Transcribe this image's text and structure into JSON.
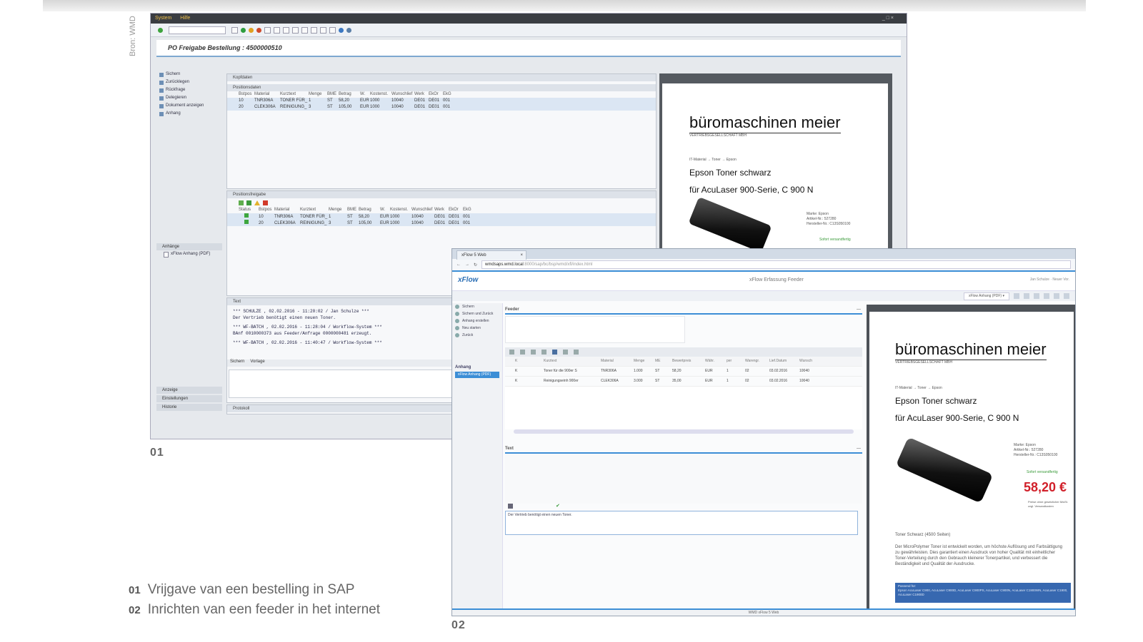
{
  "source_label": "Bron: WMD",
  "figures": [
    {
      "number": "01",
      "caption": "Vrijgave van een bestelling in SAP"
    },
    {
      "number": "02",
      "caption": "Inrichten van een feeder in het internet"
    }
  ],
  "sap": {
    "menu": [
      "System",
      "Hilfe"
    ],
    "window_controls": "_ □ ×",
    "header_title": "PO Freigabe Bestellung : 4500000510",
    "nav_buttons": [
      "Sichern",
      "Zurücklegen",
      "Rückfrage",
      "Delegieren",
      "Dokument anzeigen",
      "Anhang"
    ],
    "nav_groups_bottom": [
      "Anzeige",
      "Einstellungen",
      "Historie"
    ],
    "attachments_label": "Anhänge",
    "attachment_item": "xFlow Anhang (PDF)",
    "kopfdaten_label": "Kopfdaten",
    "positionsdaten_label": "Positionsdaten",
    "columns": [
      "Bstpos",
      "Material",
      "Kurztext",
      "Menge",
      "BME",
      "Betrag",
      "W.",
      "Kostenst.",
      "Wunschlief",
      "Werk",
      "EkOr",
      "EkG"
    ],
    "rows": [
      [
        "10",
        "TNR306A",
        "TONER FÜR_",
        "1",
        "ST",
        "58,20",
        "EUR",
        "1000",
        "10040",
        "DE01",
        "DE01",
        "001"
      ],
      [
        "20",
        "CLEK306A",
        "REINIGUNG_",
        "3",
        "ST",
        "105,00",
        "EUR",
        "1000",
        "10040",
        "DE01",
        "DE01",
        "001"
      ]
    ],
    "freigabe_label": "Positionsfreigabe",
    "status_label": "Status",
    "text_label": "Text",
    "text_lines": [
      "*** SCHULZE , 02.02.2016 - 11:20:02 / Jan Schulze ***",
      "Der Vertrieb benötigt einen neuen Toner.",
      "*** WF-BATCH , 02.02.2016 - 11:28:04 / Workflow-System ***",
      "BAnf 0010000373 aus Feeder/Anfrage 0000000481 erzeugt.",
      "*** WF-BATCH , 02.02.2016 - 11:40:47 / Workflow-System ***"
    ],
    "text_buttons": [
      "Sichern",
      "Vorlage"
    ],
    "protokoll_label": "Protokoll"
  },
  "pdf": {
    "brand": "büromaschinen meier",
    "brand_sub": "VERTRIEBSGESELLSCHAFT MBH",
    "breadcrumb": "IT-Material → Toner → Epson",
    "product_line1": "Epson Toner schwarz",
    "product_line2": "für AcuLaser 900-Serie, C 900 N",
    "specs": [
      "Marke: Epson",
      "Artikel-Nr.: 527280",
      "Hersteller-Nr.: C13S050100"
    ],
    "availability": "Sofort versandfertig",
    "price": "58,20 €",
    "price_note": "Preise ohne gesetzlicher MwSt. zzgl. Versandkosten",
    "desc_title": "Toner Schwarz (4500 Seiten)",
    "desc": "Der MicroPolymer Toner ist entwickelt worden, um höchste Auflösung und Farbsättigung zu gewährleisten. Dies garantiert einen Ausdruck von hoher Qualität mit einheitlicher Toner-Verteilung durch den Gebrauch kleinerer Tonerpartikel, und verbessert die Beständigkeit und Qualität der Ausdrucke.",
    "box_title": "Passend für:",
    "box_text": "Epson AcuLaser C900, AcuLaser C900D, AcuLaser C900PS, AcuLaser C900N, AcuLaser C1900WN, AcuLaser C1900, AcuLaser C1900D"
  },
  "xflow": {
    "tab_title": "xFlow 5 Web",
    "url_host": "wmdsaps.wmd.local",
    "url_path": ":8000/sap/bc/bsp/wmd/xfl/index.html",
    "logo": "xFlow",
    "app_title": "xFlow Erfassung Feeder",
    "user": "Jan Schulze · Neuer Vor.",
    "attachment_dropdown": "xFlow Anhang (PDF) ▾",
    "side_buttons": [
      "Sichern",
      "Sichern und Zurück",
      "Anhang erstellen",
      "Neu starten",
      "Zurück"
    ],
    "side_group": "Anhang",
    "side_attachment": "xFlow Anhang (PDF)",
    "feeder_label": "Feeder",
    "columns": [
      "K",
      "Kurztext",
      "Material",
      "Menge",
      "ME",
      "Bewertpreis",
      "Währ.",
      "per",
      "Warengr.",
      "Lief.Datum",
      "Wunsch"
    ],
    "rows": [
      [
        "K",
        "Toner für die 900er S",
        "TNR306A",
        "1.000",
        "ST",
        "58,20",
        "EUR",
        "1",
        "02",
        "03.02.2016",
        "10040"
      ],
      [
        "K",
        "Reinigungseinh 900er",
        "CLEK306A",
        "3.000",
        "ST",
        "35,00",
        "EUR",
        "1",
        "02",
        "03.02.2016",
        "10040"
      ]
    ],
    "text_label": "Text",
    "text_value": "Der Vertrieb benötigt einen neuen Toner.",
    "status_bar": "WMD xFlow 5 Web"
  }
}
